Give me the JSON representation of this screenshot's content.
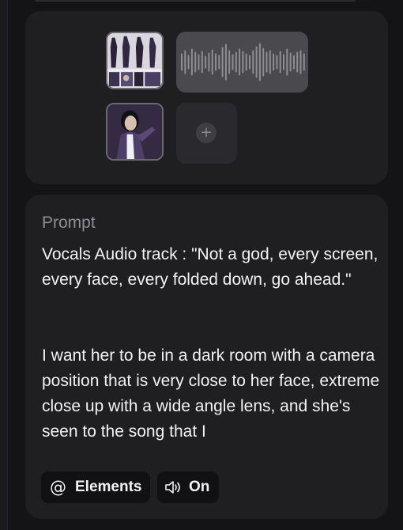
{
  "media": {
    "items": [
      {
        "kind": "image",
        "icon": "reference-image-icon",
        "alt": "outfit reference collage"
      },
      {
        "kind": "audio",
        "icon": "audio-waveform-icon"
      },
      {
        "kind": "image",
        "icon": "reference-image-icon",
        "alt": "portrait reference"
      },
      {
        "kind": "add",
        "icon": "plus-icon",
        "symbol": "+"
      }
    ]
  },
  "prompt": {
    "label": "Prompt",
    "text": "Vocals Audio track : \"Not a god, every screen, every face, every folded down, go ahead.\"\n\n\nI want her to be in a dark room with a camera position that is very close to her face, extreme close up with a wide angle lens, and she's seen to the song that I"
  },
  "toolbar": {
    "elements_label": "Elements",
    "elements_icon": "@",
    "sound_label": "On",
    "sound_icon": "speaker-icon"
  },
  "colors": {
    "background": "#141416",
    "card": "#1f1f22",
    "text": "#f2f2f4",
    "muted": "#8e8e93",
    "chip": "#111113"
  }
}
